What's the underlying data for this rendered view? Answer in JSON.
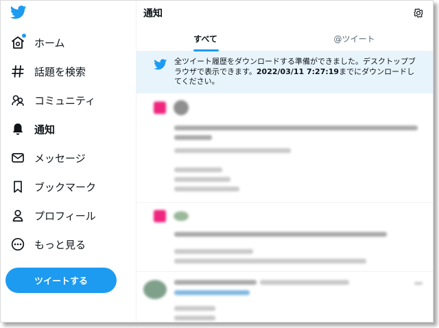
{
  "sidebar": {
    "logo_icon": "twitter-bird-icon",
    "items": [
      {
        "label": "ホーム",
        "icon": "home-icon"
      },
      {
        "label": "話題を検索",
        "icon": "hashtag-icon"
      },
      {
        "label": "コミュニティ",
        "icon": "communities-icon"
      },
      {
        "label": "通知",
        "icon": "bell-icon"
      },
      {
        "label": "メッセージ",
        "icon": "envelope-icon"
      },
      {
        "label": "ブックマーク",
        "icon": "bookmark-icon"
      },
      {
        "label": "プロフィール",
        "icon": "person-icon"
      },
      {
        "label": "もっと見る",
        "icon": "more-circle-icon"
      }
    ],
    "active_index": 3,
    "tweet_button": "ツイートする"
  },
  "main": {
    "title": "通知",
    "settings_icon": "gear-icon",
    "tabs": [
      {
        "label": "すべて",
        "selected": true
      },
      {
        "label": "@ツイート",
        "selected": false
      }
    ],
    "banner": {
      "icon": "twitter-bird-icon",
      "text_before": "全ツイート履歴をダウンロードする準備ができました。デスクトップブラウザで表示できます。",
      "datetime": "2022/03/11 7:27:19",
      "text_after": "までにダウンロードしてください。"
    }
  },
  "colors": {
    "accent": "#1d9bf0",
    "banner_bg": "#e8f4fc",
    "notification_icon": "#f0257e"
  }
}
